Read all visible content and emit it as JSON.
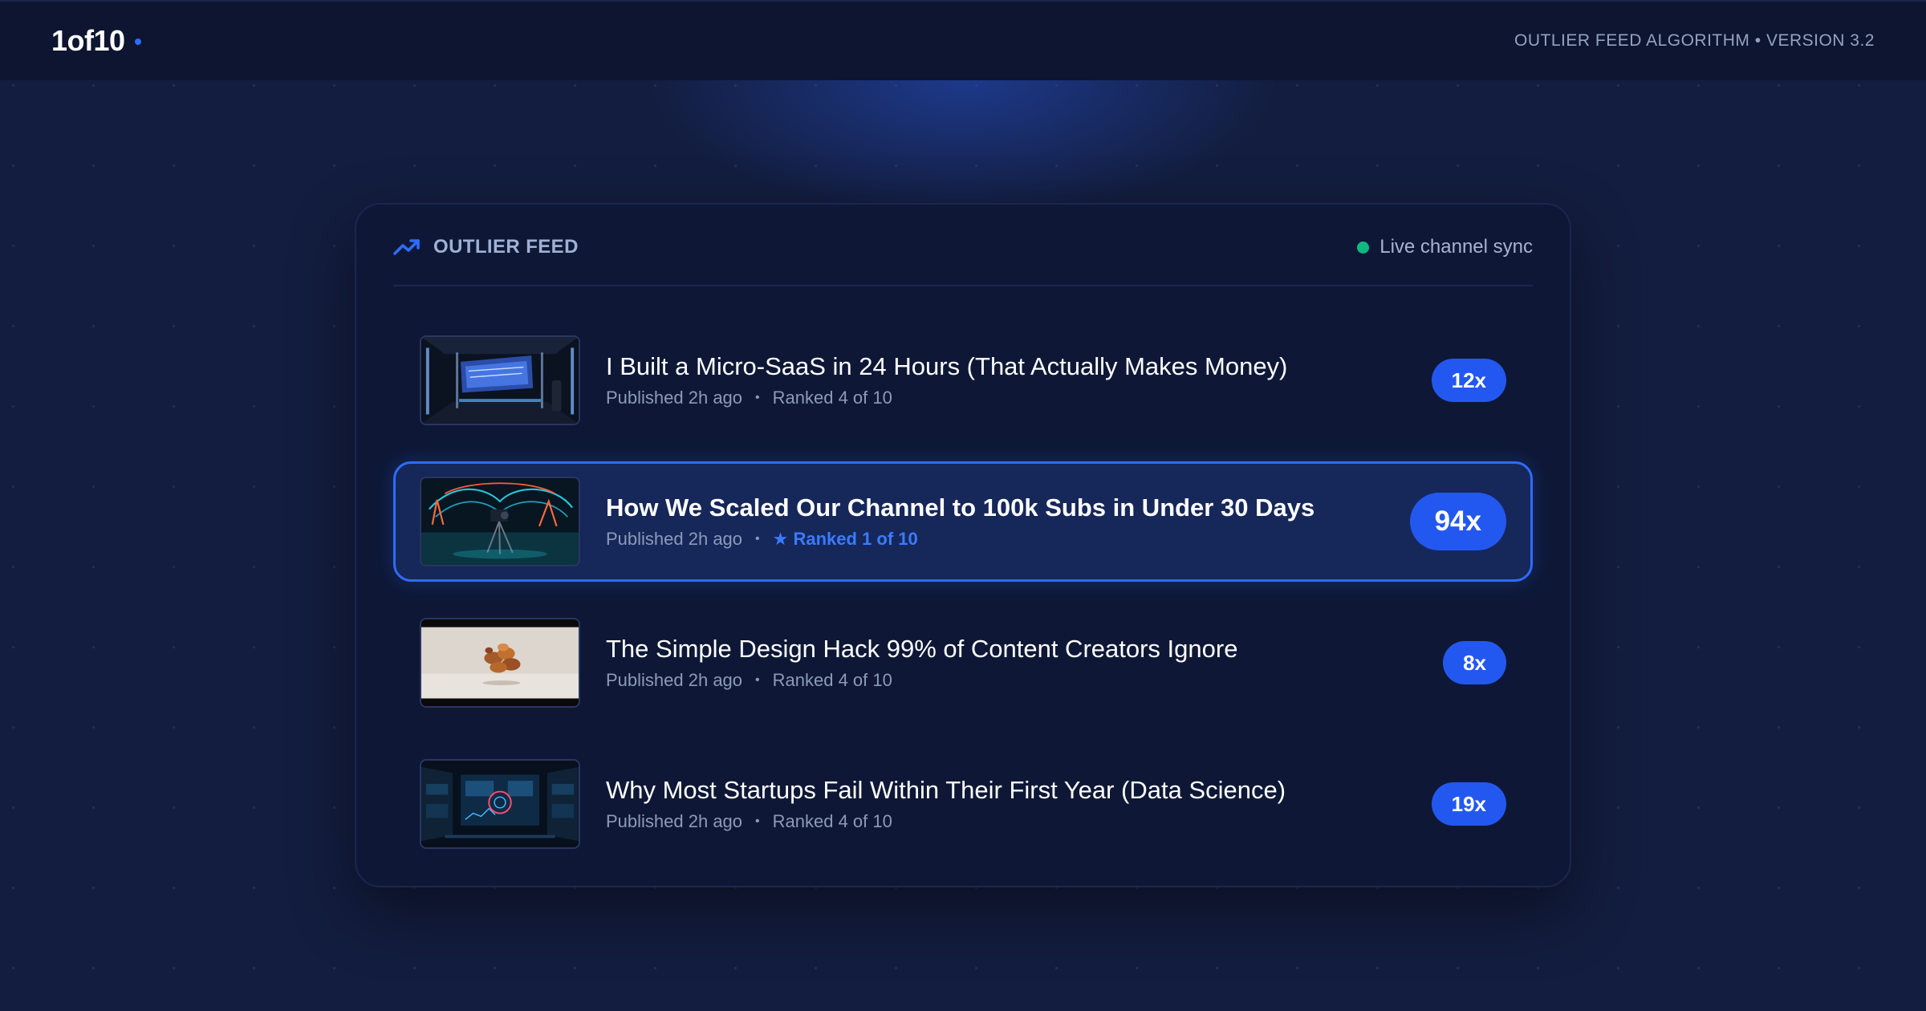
{
  "brand": {
    "name": "1of10"
  },
  "topbar": {
    "tagline": "OUTLIER FEED ALGORITHM • VERSION 3.2"
  },
  "feed": {
    "title": "OUTLIER FEED",
    "status": "Live channel sync",
    "icons": {
      "header": "trending-up-icon",
      "status": "live-dot-icon",
      "ranked": "star-icon"
    },
    "colors": {
      "accent": "#2f6bff",
      "live": "#10b981",
      "pill": "#2358f0"
    },
    "items": [
      {
        "title": "I Built a Micro-SaaS in 24 Hours (That Actually Makes Money)",
        "published": "Published 2h ago",
        "separator": "•",
        "rank": "Ranked 4 of 10",
        "multiplier": "12x",
        "highlighted": false
      },
      {
        "title": "How We Scaled Our Channel to 100k Subs in Under 30 Days",
        "published": "Published 2h ago",
        "separator": "•",
        "rank": "Ranked 1 of 10",
        "rank_icon": "★",
        "multiplier": "94x",
        "highlighted": true
      },
      {
        "title": "The Simple Design Hack 99% of Content Creators Ignore",
        "published": "Published 2h ago",
        "separator": "•",
        "rank": "Ranked 4 of 10",
        "multiplier": "8x",
        "highlighted": false
      },
      {
        "title": "Why Most Startups Fail Within Their First Year (Data Science)",
        "published": "Published 2h ago",
        "separator": "•",
        "rank": "Ranked 4 of 10",
        "multiplier": "19x",
        "highlighted": false
      }
    ]
  }
}
